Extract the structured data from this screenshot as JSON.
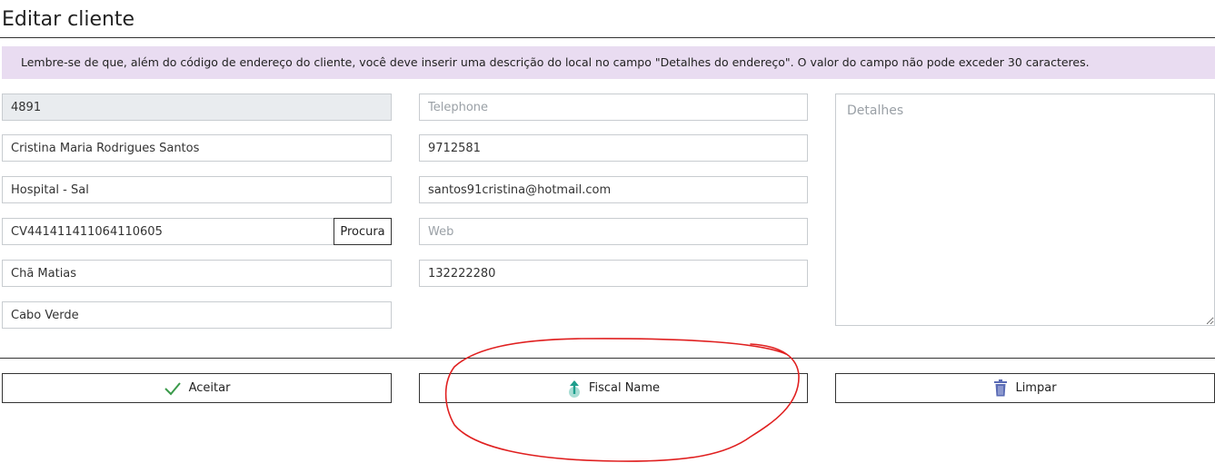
{
  "page": {
    "title": "Editar cliente"
  },
  "notice": {
    "text": "Lembre-se de que, além do código de endereço do cliente, você deve inserir uma descrição do local no campo \"Detalhes do endereço\". O valor do campo não pode exceder 30 caracteres."
  },
  "form": {
    "client_code": "4891",
    "name": "Cristina Maria Rodrigues Santos",
    "location": "Hospital - Sal",
    "address_code": "CV441411411064110605",
    "search_label": "Procura",
    "area": "Chã Matias",
    "country": "Cabo Verde",
    "telephone": {
      "value": "",
      "placeholder": "Telephone"
    },
    "mobile": "9712581",
    "email": "santos91cristina@hotmail.com",
    "web": {
      "value": "",
      "placeholder": "Web"
    },
    "tax_id": "132222280",
    "details": {
      "value": "",
      "placeholder": "Detalhes"
    }
  },
  "actions": {
    "accept_label": "Aceitar",
    "fiscal_label": "Fiscal Name",
    "clear_label": "Limpar"
  },
  "colors": {
    "notice_bg": "#e9dcf1",
    "check": "#3a9a4a",
    "upload": "#1e9e8c",
    "trash": "#5a6bb5",
    "annotation": "#e02020"
  },
  "icons": [
    "check-icon",
    "upload-icon",
    "trash-icon"
  ]
}
